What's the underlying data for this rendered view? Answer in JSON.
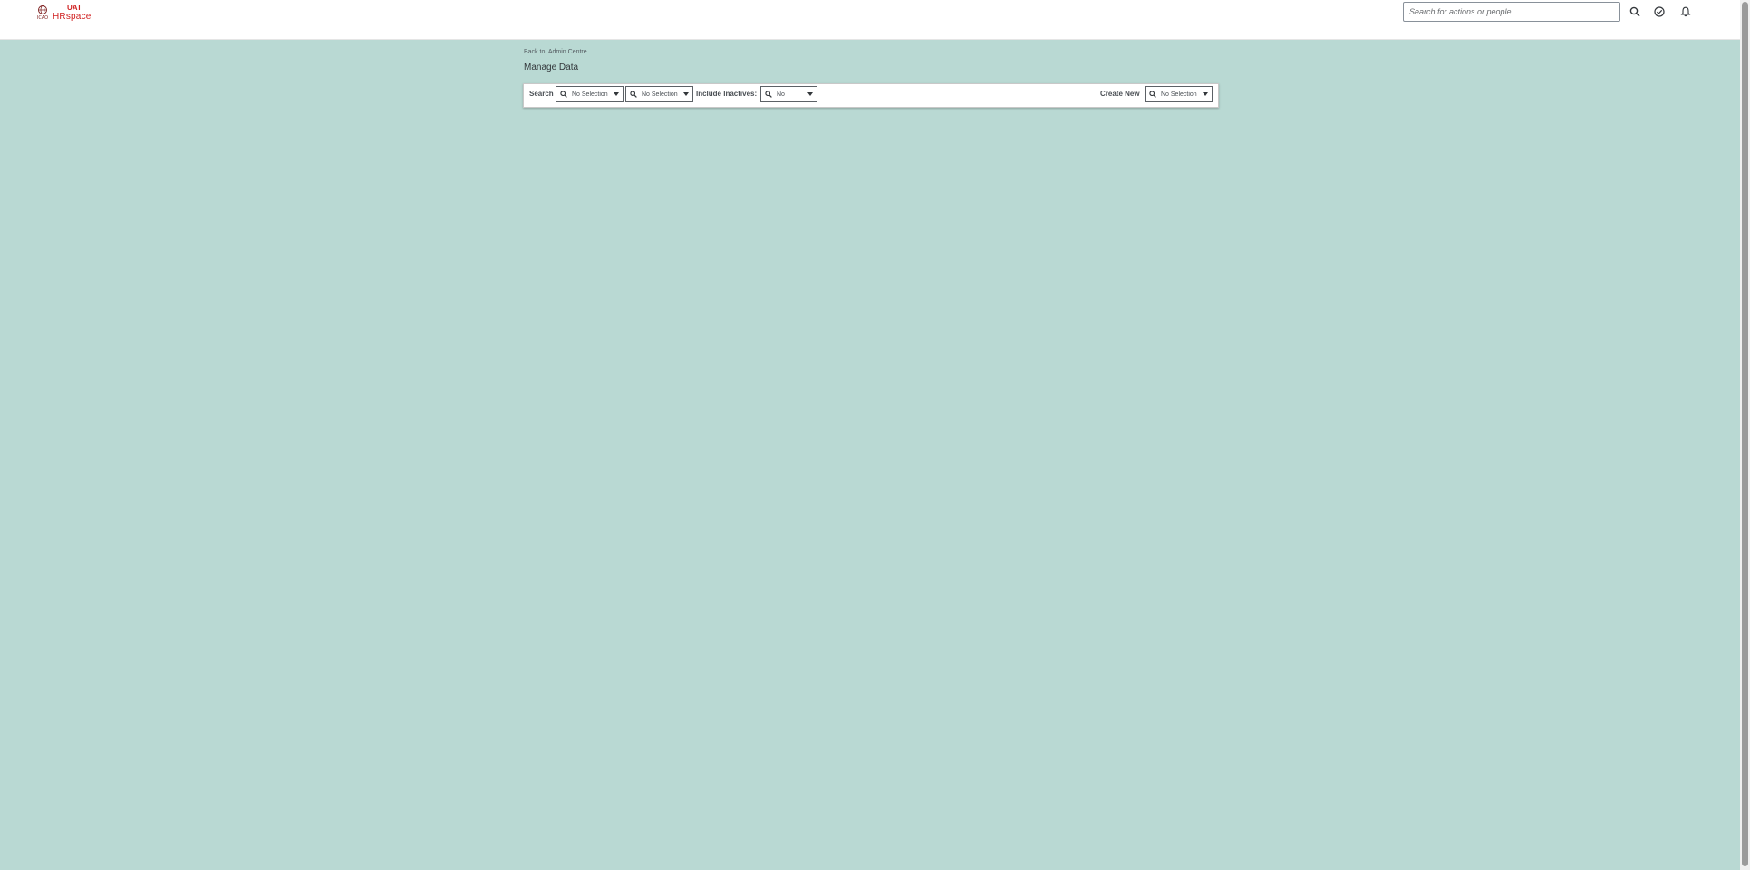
{
  "header": {
    "logo": {
      "org_text": "ICAO",
      "env": "UAT",
      "product": "HRspace"
    },
    "search": {
      "placeholder": "Search for actions or people"
    },
    "icons": [
      "search-icon",
      "approvals-icon",
      "notifications-icon"
    ]
  },
  "content": {
    "back_link": "Back to: Admin Centre",
    "title": "Manage Data",
    "toolbar": {
      "search_label": "Search",
      "search_select_1": "No Selection",
      "search_select_2": "No Selection",
      "inactives_label": "Include Inactives:",
      "inactives_value": "No",
      "create_label": "Create New",
      "create_value": "No Selection"
    }
  },
  "colors": {
    "background": "#b9d9d3",
    "brand": "#d02020"
  }
}
